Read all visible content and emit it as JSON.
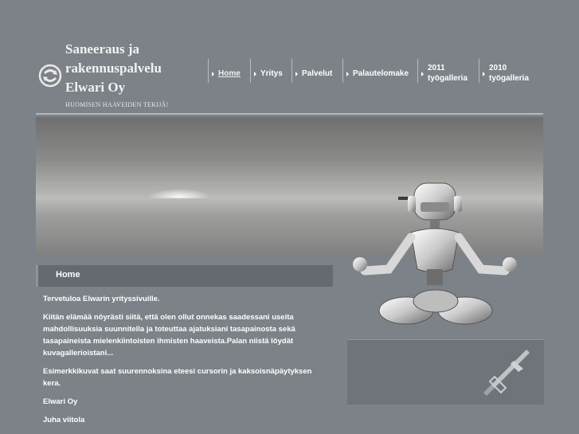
{
  "brand": {
    "name_line1": "Saneeraus ja",
    "name_line2": "rakennuspalvelu",
    "name_line3": "Elwari Oy",
    "tagline": "HUOMISEN HAAVEIDEN TEKIJÄ!"
  },
  "nav": {
    "items": [
      {
        "line1": "Home",
        "line2": ""
      },
      {
        "line1": "Yritys",
        "line2": ""
      },
      {
        "line1": "Palvelut",
        "line2": ""
      },
      {
        "line1": "Palautelomake",
        "line2": ""
      },
      {
        "line1": "2011",
        "line2": "työgalleria"
      },
      {
        "line1": "2010",
        "line2": "työgalleria"
      }
    ]
  },
  "section": {
    "title": "Home"
  },
  "content": {
    "p1": "Tervetuloa Elwarin yrityssivuille.",
    "p2": "Kiitän elämää nöyrästi siitä, että olen ollut onnekas saadessani useita mahdollisuuksia suunnitella ja toteuttaa ajatuksiani  tasapainosta sekä tasapaineista mielenkiintoisten ihmisten  haaveista.Palan niistä löydät kuvagallerioistani...",
    "p3": "Esimerkkikuvat saat suurennoksina eteesi cursorin ja kaksoisnäpäytyksen kera.",
    "p4": "Elwari Oy",
    "p5": "Juha viitola"
  },
  "colors": {
    "page_bg": "#7c8287",
    "bar_bg": "#646a6f",
    "text": "#ffffff"
  },
  "icons": {
    "logo": "circular-arrows-icon",
    "nav_bullet": "triangle-right-icon",
    "side_logo": "sword-emblem-icon"
  }
}
